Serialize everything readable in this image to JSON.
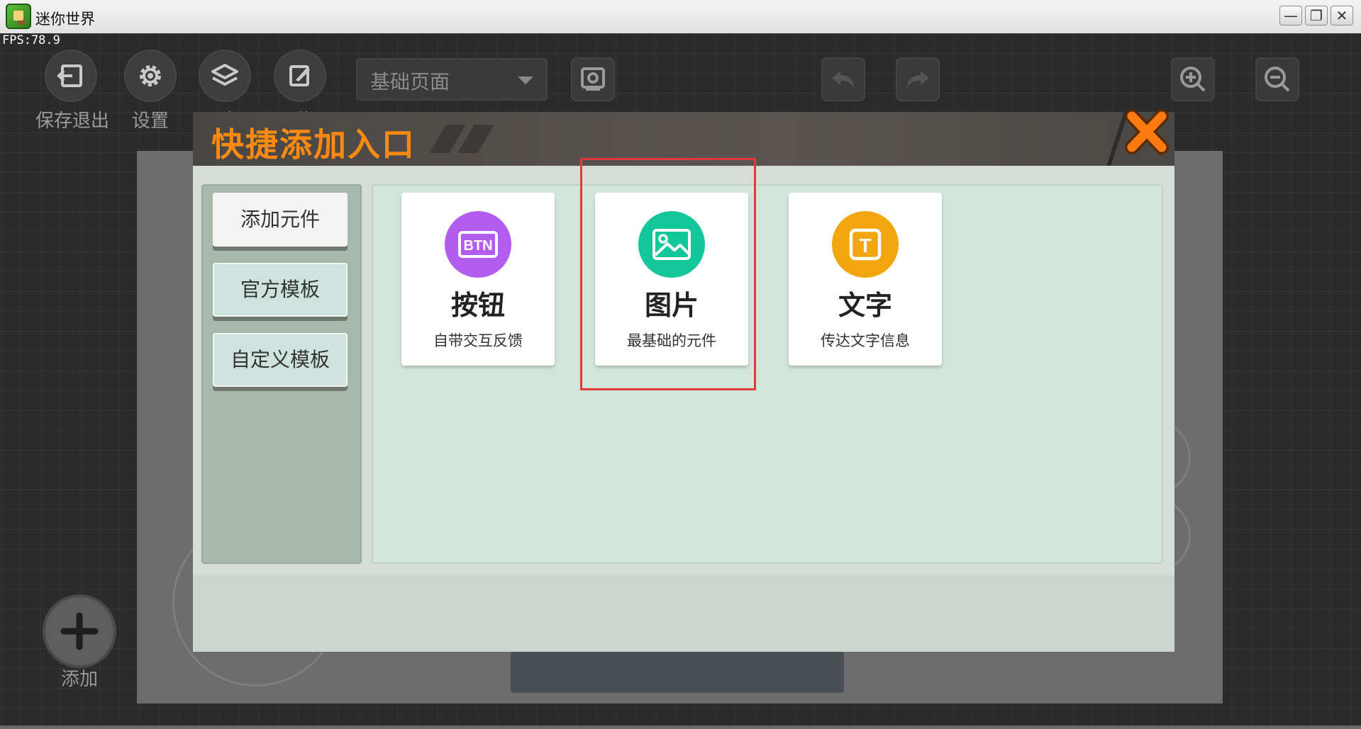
{
  "window": {
    "title": "迷你世界",
    "fps": "FPS:78.9",
    "minimize": "—",
    "maximize": "❐",
    "close": "✕"
  },
  "toolbar": {
    "save_exit": "保存退出",
    "settings": "设置",
    "layers": "层级",
    "adsorber": "吸附器",
    "page_select": "基础页面"
  },
  "add_button": {
    "label": "添加"
  },
  "dialog": {
    "title": "快捷添加入口",
    "tabs": [
      {
        "label": "添加元件",
        "active": true
      },
      {
        "label": "官方模板",
        "active": false
      },
      {
        "label": "自定义模板",
        "active": false
      }
    ],
    "cards": [
      {
        "title": "按钮",
        "desc": "自带交互反馈",
        "icon": "btn-icon",
        "color": "#b35cf0",
        "icon_text": "BTN"
      },
      {
        "title": "图片",
        "desc": "最基础的元件",
        "icon": "image-icon",
        "color": "#13c79a"
      },
      {
        "title": "文字",
        "desc": "传达文字信息",
        "icon": "text-icon",
        "color": "#f2a60e",
        "icon_text": "T"
      }
    ]
  },
  "colors": {
    "accent_orange": "#ff8a12",
    "highlight_red": "#e53935"
  }
}
